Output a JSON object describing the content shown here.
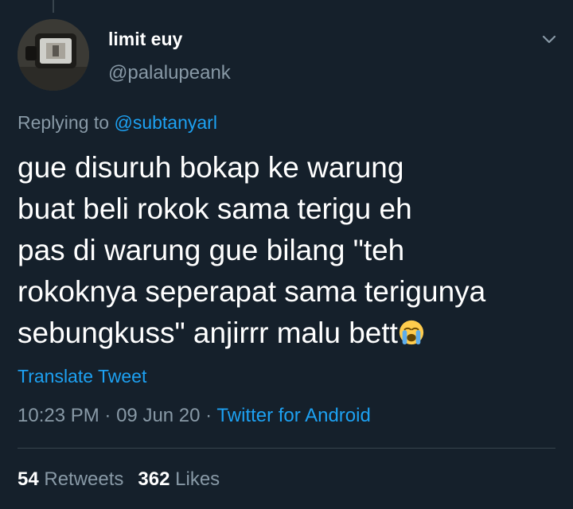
{
  "tweet": {
    "display_name": "limit euy",
    "handle": "@palalupeank",
    "reply_prefix": "Replying to",
    "reply_to": "@subtanyarl",
    "text_lines": [
      "gue disuruh bokap ke warung",
      "buat beli rokok sama terigu eh",
      "pas di warung gue bilang \"teh",
      "rokoknya seperapat sama terigunya",
      "sebungkuss\" anjirrr malu bett"
    ],
    "emoji": "loudly-crying-face",
    "translate_label": "Translate Tweet",
    "time": "10:23 PM",
    "separator": "·",
    "date": "09 Jun 20",
    "source": "Twitter for Android",
    "retweets_count": "54",
    "retweets_label": "Retweets",
    "likes_count": "362",
    "likes_label": "Likes"
  },
  "icons": {
    "menu": "chevron-down-icon",
    "avatar": "avatar"
  },
  "colors": {
    "background": "#15202b",
    "text": "#ffffff",
    "muted": "#8899a6",
    "accent": "#1da1f2",
    "divider": "#38444d"
  }
}
